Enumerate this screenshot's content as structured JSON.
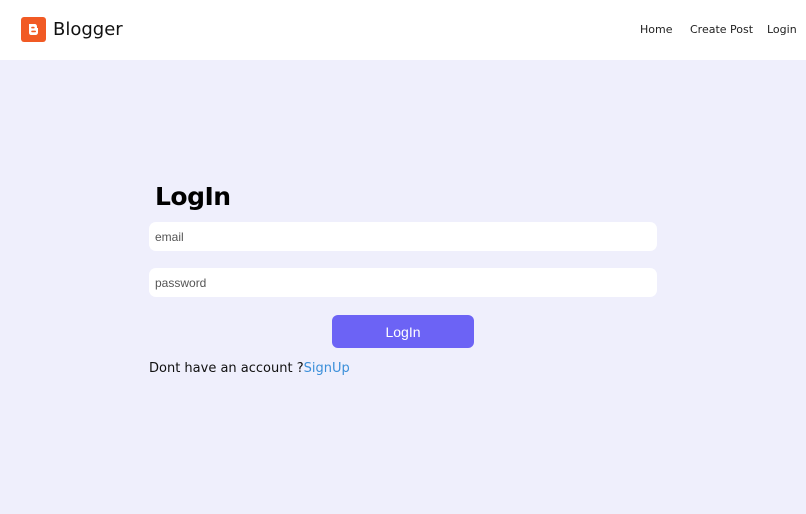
{
  "header": {
    "brand_name": "Blogger",
    "logo_icon": "blogger-logo-icon",
    "nav": {
      "home": "Home",
      "create_post": "Create Post",
      "login": "Login"
    }
  },
  "main": {
    "title": "LogIn",
    "email": {
      "placeholder": "email",
      "value": ""
    },
    "password": {
      "placeholder": "password",
      "value": ""
    },
    "login_button": "LogIn",
    "signup_prompt": "Dont have an account ?",
    "signup_link": "SignUp"
  },
  "colors": {
    "page_background": "#efeffc",
    "header_background": "#ffffff",
    "brand_orange": "#f15a24",
    "button_purple": "#6c63f5",
    "link_blue": "#3b8fd9"
  }
}
